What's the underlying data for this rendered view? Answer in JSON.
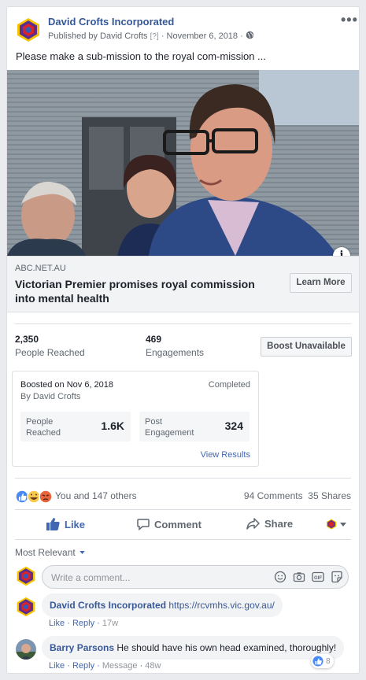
{
  "post": {
    "page_name": "David Crofts Incorporated",
    "published_by": "Published by David Crofts",
    "help_mark": "[?]",
    "date": "November 6, 2018",
    "separator": "·",
    "more_glyph": "•••",
    "text": "Please make a sub-mission to the royal com-mission ..."
  },
  "link": {
    "domain": "ABC.NET.AU",
    "title": "Victorian Premier promises royal commission into mental health",
    "cta": "Learn More",
    "info_glyph": "i"
  },
  "insights": {
    "reached_value": "2,350",
    "reached_label": "People Reached",
    "engagements_value": "469",
    "engagements_label": "Engagements",
    "boost_button": "Boost Unavailable"
  },
  "boost": {
    "boosted_on": "Boosted on Nov 6, 2018",
    "by": "By David Crofts",
    "status": "Completed",
    "people_reached_label": "People Reached",
    "people_reached_value": "1.6K",
    "post_engagement_label": "Post Engagement",
    "post_engagement_value": "324",
    "view_results": "View Results"
  },
  "reactions": {
    "summary": "You and 147 others",
    "comments": "94 Comments",
    "shares": "35 Shares"
  },
  "actions": {
    "like": "Like",
    "comment": "Comment",
    "share": "Share"
  },
  "comments_section": {
    "sort_label": "Most Relevant",
    "placeholder": "Write a comment...",
    "gif_label": "GIF",
    "comments": [
      {
        "author": "David Crofts Incorporated",
        "text": "https://rcvmhs.vic.gov.au/",
        "like": "Like",
        "reply": "Reply",
        "time": "17w"
      },
      {
        "author": "Barry Parsons",
        "text": "He should have his own head examined, thoroughly!",
        "like": "Like",
        "reply": "Reply",
        "message": "Message",
        "time": "48w",
        "like_count": "8"
      }
    ]
  },
  "colors": {
    "link_blue": "#365899",
    "like_blue": "#4267b2",
    "text_grey": "#606770",
    "logo_purple": "#5a2d8f",
    "logo_red": "#d8232a",
    "logo_yellow": "#f5c400"
  }
}
